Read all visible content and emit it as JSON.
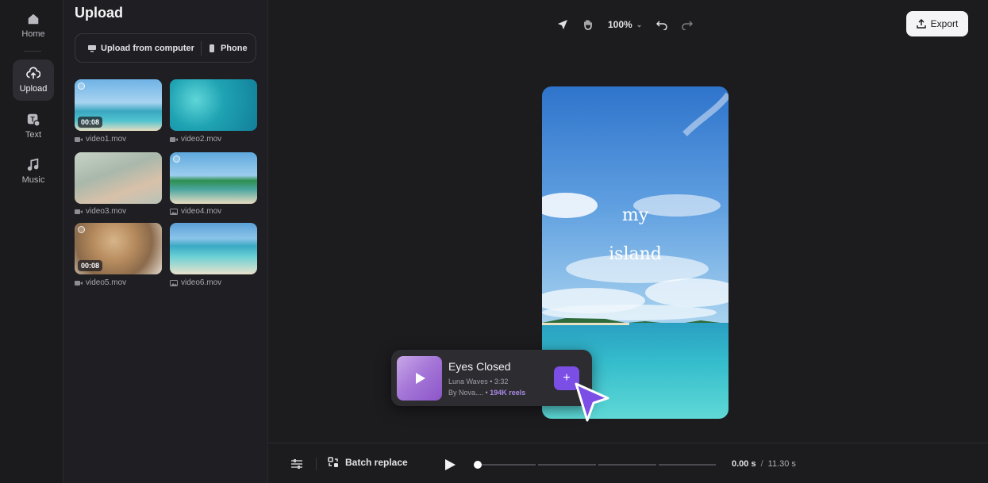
{
  "rail": {
    "items": [
      {
        "label": "Home",
        "icon": "home-icon",
        "active": false
      },
      {
        "label": "Upload",
        "icon": "cloud-upload-icon",
        "active": true
      },
      {
        "label": "Text",
        "icon": "text-icon",
        "active": false
      },
      {
        "label": "Music",
        "icon": "music-note-icon",
        "active": false
      }
    ]
  },
  "panel": {
    "title": "Upload",
    "upload_from_computer": "Upload from computer",
    "phone": "Phone",
    "media": [
      {
        "name": "video1.mov",
        "duration": "00:08",
        "type": "video"
      },
      {
        "name": "video2.mov",
        "duration": "",
        "type": "video"
      },
      {
        "name": "video3.mov",
        "duration": "",
        "type": "video"
      },
      {
        "name": "video4.mov",
        "duration": "",
        "type": "image"
      },
      {
        "name": "video5.mov",
        "duration": "00:08",
        "type": "video"
      },
      {
        "name": "video6.mov",
        "duration": "",
        "type": "image"
      }
    ]
  },
  "toolbar": {
    "zoom": "100%",
    "export_label": "Export"
  },
  "canvas": {
    "text_line1": "my",
    "text_line2": "island"
  },
  "music": {
    "title": "Eyes Closed",
    "artist_line": "Luna Waves • 3:32",
    "by_line": "By Nova.... •",
    "reels": "194K reels",
    "add_label": "+"
  },
  "timeline": {
    "batch_replace": "Batch replace",
    "current_time": "0.00 s",
    "separator": "/",
    "total_time": "11.30 s"
  },
  "colors": {
    "accent": "#7b4ee6",
    "background": "#1f1f23"
  }
}
